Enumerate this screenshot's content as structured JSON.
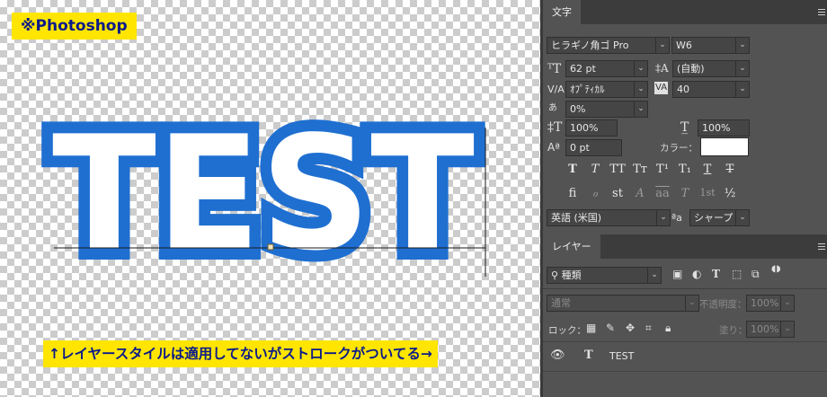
{
  "canvas": {
    "badge": "※Photoshop",
    "text": "TEST",
    "note": "↑レイヤースタイルは適用してないがストロークがついてる→",
    "colors": {
      "stroke": "#1f6fd1",
      "fill": "#ffffff",
      "badge_bg": "#ffe500",
      "badge_text": "#0a1a8a"
    }
  },
  "character_panel": {
    "tab": "文字",
    "font_family": "ヒラギノ角ゴ Pro",
    "font_style": "W6",
    "font_size": "62 pt",
    "leading": "(自動)",
    "kerning": "ｵﾌﾟﾃｨｶﾙ",
    "tracking": "40",
    "tsume": "0%",
    "vertical_scale": "100%",
    "horizontal_scale": "100%",
    "baseline_shift": "0 pt",
    "color_label": "カラー：",
    "color_value": "#ffffff",
    "format_buttons": [
      "T",
      "T",
      "TT",
      "Tт",
      "T¹",
      "T₁",
      "T",
      "T"
    ],
    "opentype_buttons": [
      "fi",
      "ℴ",
      "st",
      "A",
      "aa",
      "T",
      "1st",
      "½"
    ],
    "language": "英語 (米国)",
    "aa_label": "ªa",
    "antialias": "シャープ"
  },
  "layers_panel": {
    "tab": "レイヤー",
    "filter_kind": "種類",
    "blend_mode": "通常",
    "opacity_label": "不透明度：",
    "opacity_value": "100%",
    "lock_label": "ロック：",
    "fill_label": "塗り：",
    "fill_value": "100%",
    "layer": {
      "type_icon": "T",
      "name": "TEST"
    }
  }
}
